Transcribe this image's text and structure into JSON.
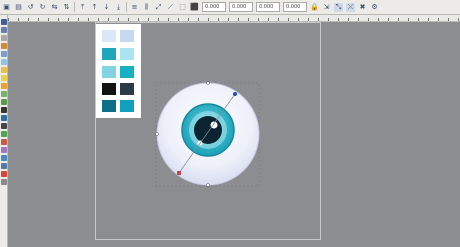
{
  "toolbar": {
    "icons": [
      "select-all-icon",
      "select-same-icon",
      "rotate-ccw-icon",
      "rotate-cw-icon",
      "flip-h-icon",
      "flip-v-icon",
      "raise-icon",
      "lower-icon",
      "raise-top-icon",
      "lower-bottom-icon",
      "align-icon",
      "distribute-icon"
    ],
    "x_value": "0.000",
    "y_value": "0.000",
    "w_value": "0.000",
    "h_value": "0.000"
  },
  "palette": {
    "colors": [
      "#dbe7f6",
      "#c7d9f1",
      "#1fa6bb",
      "#a9e4f0",
      "#83d4e3",
      "#1ab0c4",
      "#101214",
      "#2d3b44",
      "#0d6f87",
      "#119fc0"
    ]
  },
  "eye": {
    "sclera_color": "#f2f4fb",
    "iris_color": "#2cb1c6",
    "pupil_color": "#0c2430",
    "gradient_handle_color": "#2a4fb2"
  }
}
